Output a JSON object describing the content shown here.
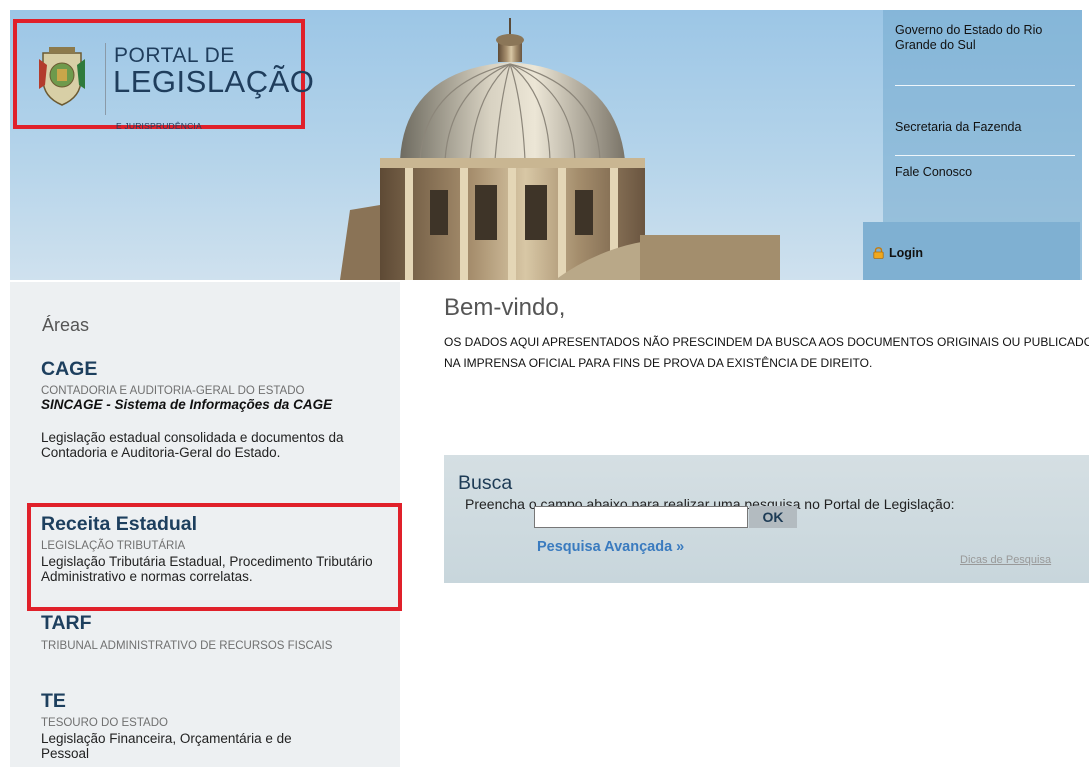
{
  "header": {
    "logo": {
      "line1": "PORTAL DE",
      "line2": "LEGISLAÇÃO",
      "line3": "E JURISPRUDÊNCIA",
      "coat_icon": "coat-of-arms-icon"
    },
    "nav": [
      {
        "label": "Governo do Estado do Rio Grande do Sul"
      },
      {
        "label": "Secretaria da Fazenda"
      },
      {
        "label": "Fale Conosco"
      }
    ],
    "login": {
      "label": "Login",
      "icon": "lock-icon"
    }
  },
  "left": {
    "areas_title": "Áreas",
    "areas": [
      {
        "title": "CAGE",
        "subtitle": "CONTADORIA E AUDITORIA-GERAL DO ESTADO",
        "system": "SINCAGE - Sistema de Informações da CAGE",
        "desc": "Legislação estadual consolidada e documentos da Contadoria e Auditoria-Geral do Estado."
      },
      {
        "title": "Receita Estadual",
        "subtitle": "LEGISLAÇÃO TRIBUTÁRIA",
        "desc": "Legislação Tributária Estadual, Procedimento Tributário Administrativo e normas correlatas."
      },
      {
        "title": "TARF",
        "subtitle": "TRIBUNAL ADMINISTRATIVO DE RECURSOS FISCAIS"
      },
      {
        "title": "TE",
        "subtitle": "TESOURO DO ESTADO",
        "desc": "Legislação Financeira, Orçamentária e de Pessoal"
      }
    ]
  },
  "main": {
    "welcome_title": "Bem-vindo,",
    "welcome_text": "OS DADOS AQUI APRESENTADOS NÃO PRESCINDEM DA BUSCA AOS DOCUMENTOS ORIGINAIS OU PUBLICADOS NA IMPRENSA OFICIAL PARA FINS DE PROVA DA EXISTÊNCIA DE DIREITO.",
    "search": {
      "title": "Busca",
      "instructions": "Preencha o campo abaixo para realizar uma pesquisa no Portal de Legislação:",
      "value": "",
      "placeholder": "",
      "button": "OK",
      "advanced": "Pesquisa Avançada »",
      "tips": "Dicas de Pesquisa"
    }
  },
  "colors": {
    "highlight_border": "#e0202a",
    "title_blue": "#1d3f5e",
    "link_blue": "#3a7bbf",
    "sidebar_bg": "#edf0f2",
    "search_bg": "#d0dbe0"
  }
}
